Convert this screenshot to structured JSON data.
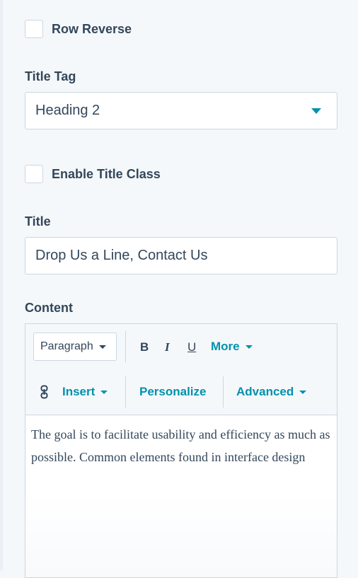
{
  "row_reverse": {
    "label": "Row Reverse",
    "checked": false
  },
  "title_tag": {
    "label": "Title Tag",
    "selected": "Heading 2"
  },
  "enable_title_class": {
    "label": "Enable Title Class",
    "checked": false
  },
  "title_field": {
    "label": "Title",
    "value": "Drop Us a Line, Contact Us"
  },
  "content": {
    "label": "Content",
    "toolbar": {
      "paragraph_select": "Paragraph",
      "bold": "B",
      "italic": "I",
      "underline": "U",
      "more": "More",
      "insert": "Insert",
      "personalize": "Personalize",
      "advanced": "Advanced",
      "link_icon": "link-icon"
    },
    "body_text": "The goal is to facilitate usability and efficiency as much as possible. Common elements found in interface design"
  },
  "colors": {
    "accent": "#0091ae",
    "text": "#33475b",
    "border": "#cbd6e2",
    "panel_bg": "#f5f8fa"
  }
}
